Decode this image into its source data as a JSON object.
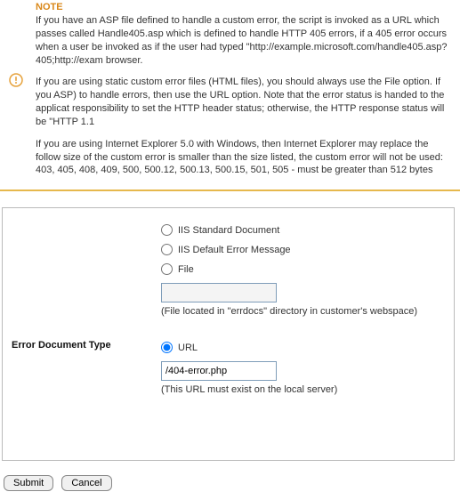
{
  "note": {
    "heading": "NOTE",
    "p1": "If you have an ASP file defined to handle a custom error, the script is invoked as a URL which passes called Handle405.asp which is defined to handle HTTP 405 errors, if a 405 error occurs when a user be invoked as if the user had typed \"http://example.microsoft.com/handle405.asp?405;http://exam browser.",
    "p2": "If you are using static custom error files (HTML files), you should always use the File option. If you ASP) to handle errors, then use the URL option. Note that the error status is handed to the applicat responsibility to set the HTTP header status; otherwise, the HTTP response status will be \"HTTP 1.1",
    "p3": "If you are using Internet Explorer 5.0 with Windows, then Internet Explorer may replace the follow size of the custom error is smaller than the size listed, the custom error will not be used: 403, 405, 408, 409, 500, 500.12, 500.13, 500.15, 501, 505 - must be greater than 512 bytes"
  },
  "form": {
    "label": "Error Document Type",
    "options": {
      "standard": "IIS Standard Document",
      "default_msg": "IIS Default Error Message",
      "file": "File",
      "file_hint": "(File located in \"errdocs\" directory in customer's webspace)",
      "url": "URL",
      "url_value": "/404-error.php",
      "url_hint": "(This URL must exist on the local server)"
    }
  },
  "buttons": {
    "submit": "Submit",
    "cancel": "Cancel"
  }
}
